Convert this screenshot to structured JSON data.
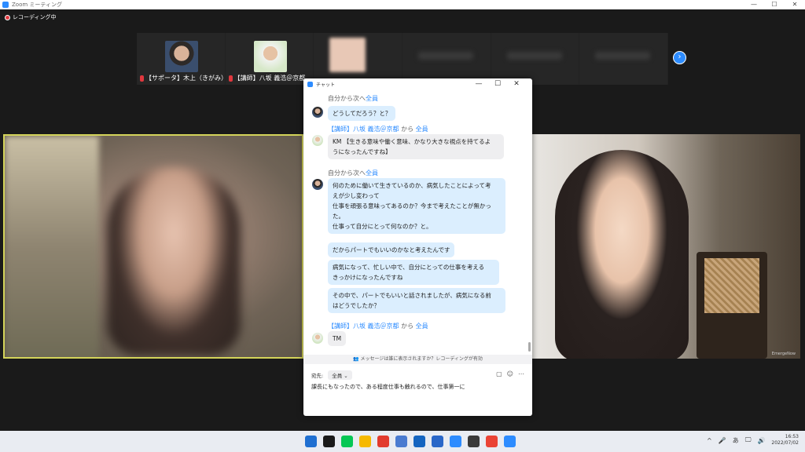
{
  "window": {
    "title": "Zoom ミーティング",
    "controls": [
      "—",
      "☐",
      "✕"
    ]
  },
  "recording": {
    "label": "レコーディング中"
  },
  "gallery": {
    "participants": [
      {
        "name": "【サポータ】木上（きがみ）…",
        "muted": true,
        "face_color": "#6b5b52"
      },
      {
        "name": "【講師】八坂 義浩＠京都",
        "muted": true,
        "face_color": "#d9e8d0"
      },
      {
        "name": "",
        "muted": false,
        "face_color": "#e9c9bb"
      },
      {
        "name": "",
        "muted": false
      },
      {
        "name": "",
        "muted": false
      },
      {
        "name": "",
        "muted": false
      }
    ],
    "next_icon": "chevron-right-icon"
  },
  "chat": {
    "title": "チャット",
    "controls": [
      "—",
      "☐",
      "✕"
    ],
    "messages": [
      {
        "header_prefix": "自分から次へ",
        "recipient": "全員",
        "sender": "",
        "bubbles": [
          "どうしてだろう？と？"
        ],
        "self": true
      },
      {
        "header_prefix": "",
        "recipient": "全員",
        "sender": "【講師】八坂 義浩＠京都",
        "from_word": " から ",
        "bubbles": [
          "KM 【生きる意味や働く意味、かなり大きな視点を持てるよ\nうになったんですね】"
        ],
        "self": false
      },
      {
        "header_prefix": "自分から次へ",
        "recipient": "全員",
        "sender": "",
        "bubbles": [
          "何のために働いて生きているのか、病気したことによって考\nえが少し変わって\n仕事を頑張る意味ってあるのか？今まで考えたことが無かっ\nた。\n仕事って自分にとって何なのか？と。",
          "だからパートでもいいのかなと考えたんです",
          "病気になって、忙しい中で、自分にとっての仕事を考える\nきっかけになったんですね",
          "その中で、パートでもいいと話されましたが、病気になる前\nはどうでしたか？"
        ],
        "self": true
      },
      {
        "header_prefix": "",
        "recipient": "全員",
        "sender": "【講師】八坂 義浩＠京都",
        "from_word": " から ",
        "bubbles": [
          "TM"
        ],
        "self": false
      }
    ],
    "notice": "メッセージは誰に表示されますか？レコーディングが有効",
    "compose": {
      "to_label": "宛先:",
      "to_value": "全員 ⌄",
      "text": "課長にもなったので、ある程度仕事も触れるので、仕事第一に"
    }
  },
  "video_right_tag": "EmergeNow",
  "taskbar": {
    "app_colors": [
      "#1f6fd1",
      "#1a1a1a",
      "#06c755",
      "#f6b900",
      "#e23b2e",
      "#4a7bd0",
      "#1565c0",
      "#2a67c8",
      "#2d8cff",
      "#3a3a3a",
      "#ea4335",
      "#2d8cff"
    ],
    "tray": [
      "^",
      "🎤",
      "あ",
      "🖵",
      "🔊"
    ],
    "time": "16:53",
    "date": "2022/07/02"
  }
}
